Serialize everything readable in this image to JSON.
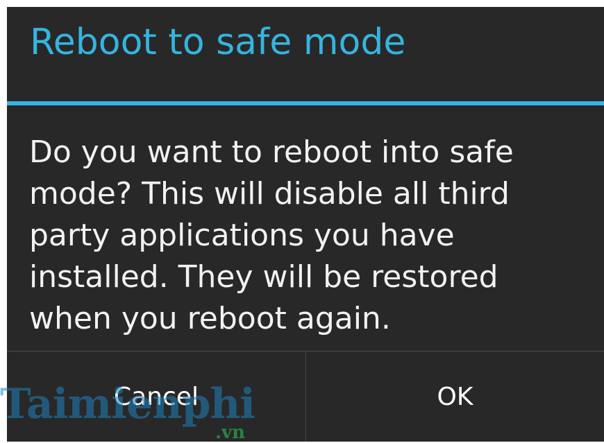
{
  "dialog": {
    "title": "Reboot to safe mode",
    "message": "Do you want to reboot into safe mode? This will disable all third party applications you have installed. They will be restored when you reboot again.",
    "buttons": {
      "cancel": "Cancel",
      "ok": "OK"
    }
  },
  "watermark": {
    "brand": "Taimienphi",
    "suffix": ".vn"
  },
  "colors": {
    "accent": "#33b5e5",
    "dialog_background": "#282828",
    "title_text": "#35b4e0",
    "body_text": "#f2f2f2"
  }
}
